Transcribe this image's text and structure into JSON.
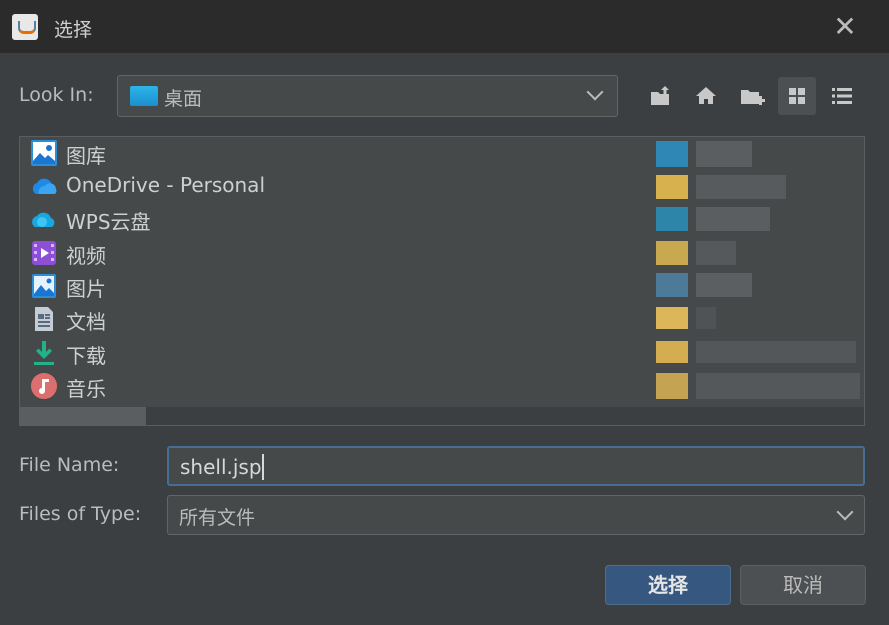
{
  "window": {
    "title": "选择"
  },
  "lookin": {
    "label": "Look In:",
    "selected": "桌面"
  },
  "files": [
    {
      "name": "图库",
      "icon": "gallery-icon"
    },
    {
      "name": "OneDrive - Personal",
      "icon": "onedrive-icon"
    },
    {
      "name": "WPS云盘",
      "icon": "wps-cloud-icon"
    },
    {
      "name": "视频",
      "icon": "video-folder-icon"
    },
    {
      "name": "图片",
      "icon": "pictures-folder-icon"
    },
    {
      "name": "文档",
      "icon": "documents-folder-icon"
    },
    {
      "name": "下载",
      "icon": "downloads-folder-icon"
    },
    {
      "name": "音乐",
      "icon": "music-folder-icon"
    }
  ],
  "filename": {
    "label": "File Name:",
    "value": "shell.jsp"
  },
  "filetype": {
    "label": "Files of Type:",
    "selected": "所有文件"
  },
  "buttons": {
    "confirm": "选择",
    "cancel": "取消"
  },
  "colors": {
    "background": "#3c3f41",
    "titlebar": "#2b2b2b",
    "accent": "#365880",
    "focus_border": "#466d94"
  }
}
